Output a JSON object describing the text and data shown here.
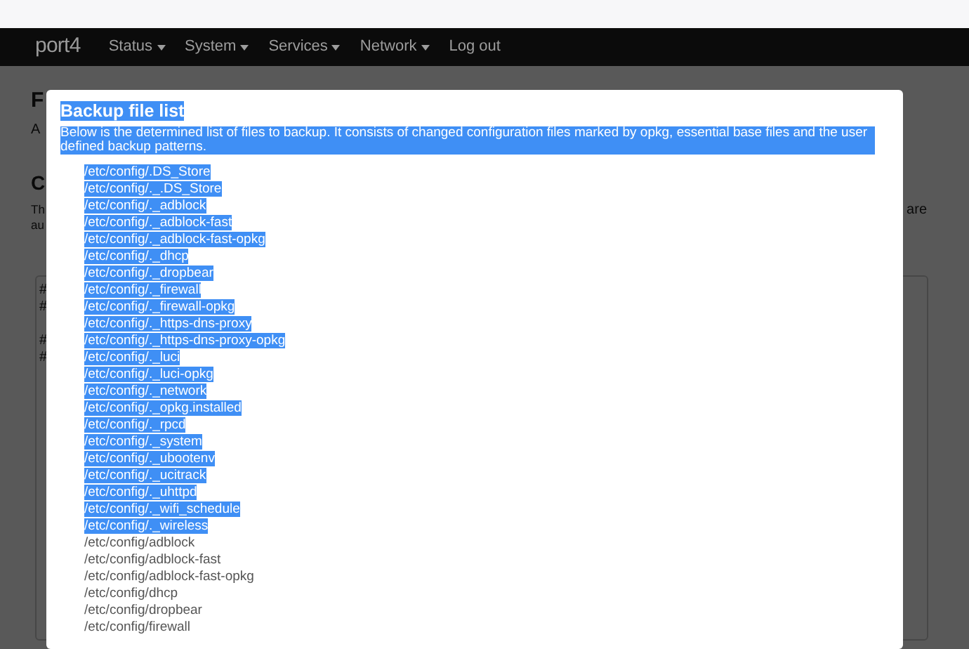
{
  "navbar": {
    "brand": "port4",
    "menu": [
      {
        "label": "Status",
        "dropdown": true
      },
      {
        "label": "System",
        "dropdown": true
      },
      {
        "label": "Services",
        "dropdown": true
      },
      {
        "label": "Network",
        "dropdown": true
      },
      {
        "label": "Log out",
        "dropdown": false
      }
    ]
  },
  "background_page": {
    "heading": "F",
    "field_text": "A",
    "section_heading": "C",
    "text_lines": [
      "Th",
      "au"
    ],
    "text_right": "are",
    "textarea_lines": [
      "#",
      "#",
      "#",
      "#"
    ]
  },
  "modal": {
    "title": "Backup file list",
    "title_highlighted": true,
    "description": "Below is the determined list of files to backup. It consists of changed configuration files marked by opkg, essential base files and the user defined backup patterns.",
    "description_highlighted": true,
    "files": [
      {
        "path": "/etc/config/.DS_Store",
        "selected": true
      },
      {
        "path": "/etc/config/._.DS_Store",
        "selected": true
      },
      {
        "path": "/etc/config/._adblock",
        "selected": true
      },
      {
        "path": "/etc/config/._adblock-fast",
        "selected": true
      },
      {
        "path": "/etc/config/._adblock-fast-opkg",
        "selected": true
      },
      {
        "path": "/etc/config/._dhcp",
        "selected": true
      },
      {
        "path": "/etc/config/._dropbear",
        "selected": true
      },
      {
        "path": "/etc/config/._firewall",
        "selected": true
      },
      {
        "path": "/etc/config/._firewall-opkg",
        "selected": true
      },
      {
        "path": "/etc/config/._https-dns-proxy",
        "selected": true
      },
      {
        "path": "/etc/config/._https-dns-proxy-opkg",
        "selected": true
      },
      {
        "path": "/etc/config/._luci",
        "selected": true
      },
      {
        "path": "/etc/config/._luci-opkg",
        "selected": true
      },
      {
        "path": "/etc/config/._network",
        "selected": true
      },
      {
        "path": "/etc/config/._opkg.installed",
        "selected": true
      },
      {
        "path": "/etc/config/._rpcd",
        "selected": true
      },
      {
        "path": "/etc/config/._system",
        "selected": true
      },
      {
        "path": "/etc/config/._ubootenv",
        "selected": true
      },
      {
        "path": "/etc/config/._ucitrack",
        "selected": true
      },
      {
        "path": "/etc/config/._uhttpd",
        "selected": true
      },
      {
        "path": "/etc/config/._wifi_schedule",
        "selected": true
      },
      {
        "path": "/etc/config/._wireless",
        "selected": true
      },
      {
        "path": "/etc/config/adblock",
        "selected": false
      },
      {
        "path": "/etc/config/adblock-fast",
        "selected": false
      },
      {
        "path": "/etc/config/adblock-fast-opkg",
        "selected": false
      },
      {
        "path": "/etc/config/dhcp",
        "selected": false
      },
      {
        "path": "/etc/config/dropbear",
        "selected": false
      },
      {
        "path": "/etc/config/firewall",
        "selected": false
      }
    ]
  }
}
